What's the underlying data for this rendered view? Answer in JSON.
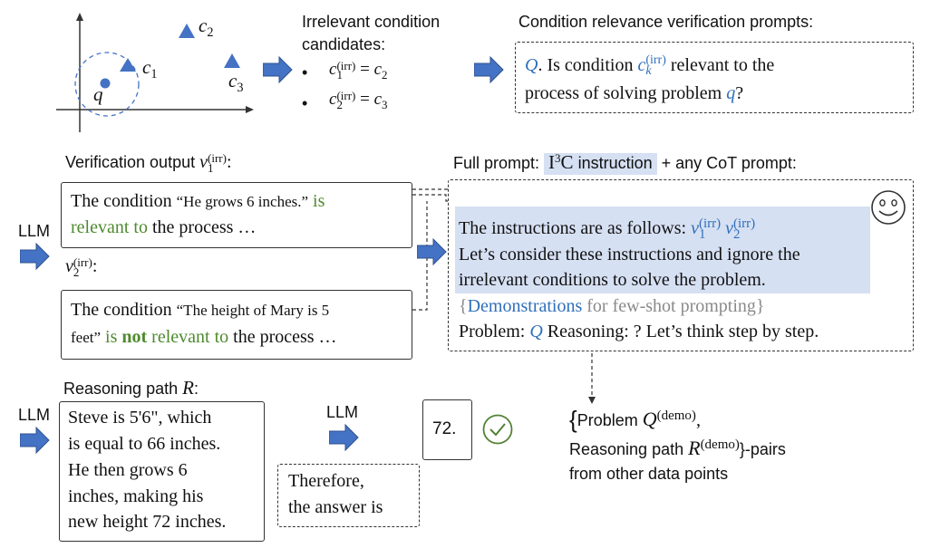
{
  "scatter": {
    "q": "q",
    "c1": "c1",
    "c2": "c2",
    "c3": "c3",
    "point_color": "#4472c4"
  },
  "candidates": {
    "title_line1": "Irrelevant condition",
    "title_line2": "candidates:",
    "item1": "c₁^(irr) = c₂",
    "item2": "c₂^(irr) = c₃"
  },
  "verify_prompt": {
    "title": "Condition relevance verification prompts:",
    "q_symbol": "Q",
    "part1": ". Is condition ",
    "ck": "c",
    "part2": " relevant to the",
    "line2_prefix": "process of solving problem ",
    "q_small": "q",
    "line2_suffix": "?"
  },
  "verification_output": {
    "title": "Verification output ",
    "v1_label": "v",
    "v2_label": "v",
    "irr": "(irr)",
    "box1": {
      "t1": "The condition ",
      "quote": "“He grows 6 inches.”",
      "t2": " is",
      "t3": "relevant to",
      "t4": " the process …"
    },
    "box2": {
      "t1": "The condition ",
      "quote1": "“The height of Mary is 5",
      "quote2": "feet”",
      "t2": " is ",
      "not": "not",
      "t3": " relevant to",
      "t4": " the process …"
    }
  },
  "llm": {
    "label": "LLM"
  },
  "full_prompt": {
    "title_prefix": "Full prompt:",
    "i3c_roman": "I",
    "i3c_sup": "3",
    "i3c_c": "C",
    "i3c_text": " instruction",
    "title_suffix": "+ any CoT prompt:",
    "line1": "The instructions are as follows: ",
    "v1": "v",
    "v2": "v",
    "line2": "Let’s consider these instructions and ignore the",
    "line3": "irrelevant conditions to solve the problem.",
    "demo_open": "{",
    "demo_word": "Demonstrations",
    "demo_rest": " for few-shot prompting}",
    "problem": "Problem: ",
    "q": "Q",
    "reasoning": " Reasoning: ? Let’s think step by step.",
    "highlight_color": "#d6e0f3"
  },
  "reasoning": {
    "title": "Reasoning path ",
    "r": "R",
    "lines": [
      "Steve is 5'6\", which",
      "is equal to 66 inches.",
      "He then grows 6",
      "inches, making his",
      "new height 72 inches."
    ],
    "therefore1": "Therefore,",
    "therefore2": "the answer is",
    "answer": "72."
  },
  "pairs": {
    "brace": "{",
    "problem": "Problem ",
    "qdemo": "Q",
    "demo": "(demo)",
    "comma": ",",
    "reasoning": "Reasoning path ",
    "rdemo": "R",
    "suffix": "}-pairs",
    "line3": "from other data points"
  }
}
